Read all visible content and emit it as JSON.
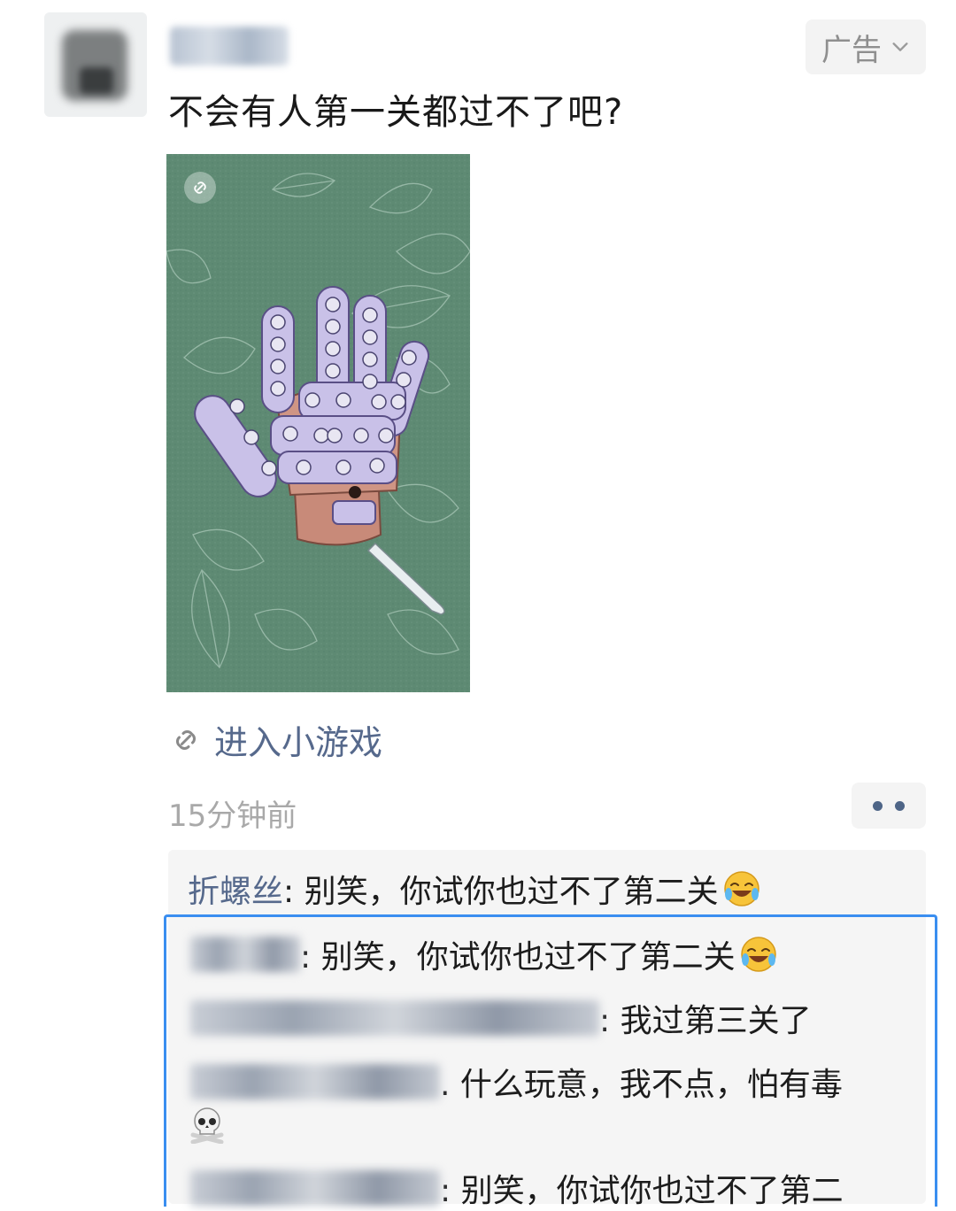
{
  "post": {
    "ad_label": "广告",
    "text": "不会有人第一关都过不了吧?",
    "link_label": "进入小游戏",
    "timestamp": "15分钟前"
  },
  "comments": [
    {
      "author": "折螺丝",
      "author_visible": true,
      "text": ": 别笑，你试你也过不了第二关"
    },
    {
      "author_visible": false,
      "text": ": 别笑，你试你也过不了第二关"
    },
    {
      "author_visible": false,
      "text": ": 我过第三关了"
    },
    {
      "author_visible": false,
      "text": ". 什么玩意，我不点，怕有毒"
    },
    {
      "author_visible": false,
      "text": ": 别笑，你试你也过不了第二"
    }
  ],
  "icons": {
    "chevron": "chevron-down-icon",
    "mini_program": "link-icon",
    "more": "more-dots-icon",
    "emoji_laugh": "laugh-cry-emoji-icon",
    "emoji_skull": "skull-crossbones-emoji-icon"
  },
  "colors": {
    "link_blue": "#56698c",
    "selection_blue": "#3a8ef0",
    "game_bg_green": "#5f8a74"
  }
}
